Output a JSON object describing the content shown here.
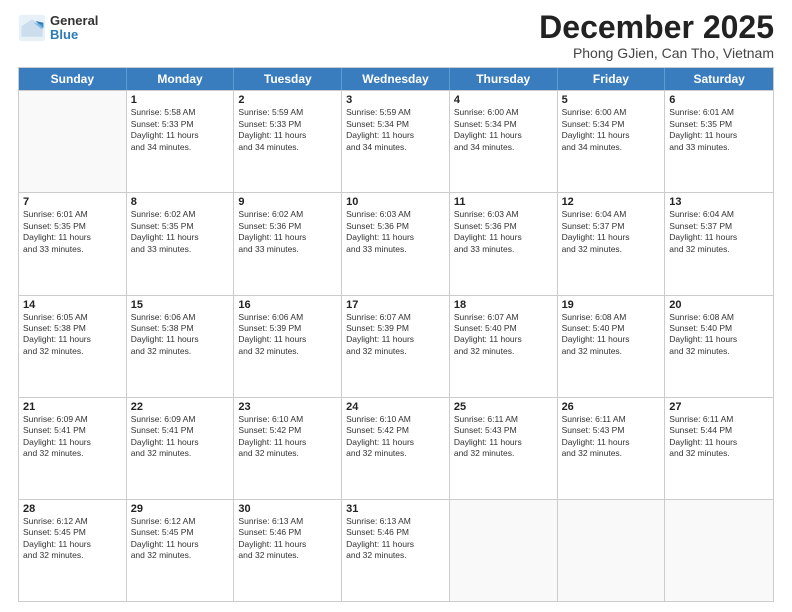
{
  "logo": {
    "general": "General",
    "blue": "Blue"
  },
  "title": "December 2025",
  "subtitle": "Phong GJien, Can Tho, Vietnam",
  "header_days": [
    "Sunday",
    "Monday",
    "Tuesday",
    "Wednesday",
    "Thursday",
    "Friday",
    "Saturday"
  ],
  "weeks": [
    [
      {
        "day": "",
        "info": ""
      },
      {
        "day": "1",
        "info": "Sunrise: 5:58 AM\nSunset: 5:33 PM\nDaylight: 11 hours\nand 34 minutes."
      },
      {
        "day": "2",
        "info": "Sunrise: 5:59 AM\nSunset: 5:33 PM\nDaylight: 11 hours\nand 34 minutes."
      },
      {
        "day": "3",
        "info": "Sunrise: 5:59 AM\nSunset: 5:34 PM\nDaylight: 11 hours\nand 34 minutes."
      },
      {
        "day": "4",
        "info": "Sunrise: 6:00 AM\nSunset: 5:34 PM\nDaylight: 11 hours\nand 34 minutes."
      },
      {
        "day": "5",
        "info": "Sunrise: 6:00 AM\nSunset: 5:34 PM\nDaylight: 11 hours\nand 34 minutes."
      },
      {
        "day": "6",
        "info": "Sunrise: 6:01 AM\nSunset: 5:35 PM\nDaylight: 11 hours\nand 33 minutes."
      }
    ],
    [
      {
        "day": "7",
        "info": "Sunrise: 6:01 AM\nSunset: 5:35 PM\nDaylight: 11 hours\nand 33 minutes."
      },
      {
        "day": "8",
        "info": "Sunrise: 6:02 AM\nSunset: 5:35 PM\nDaylight: 11 hours\nand 33 minutes."
      },
      {
        "day": "9",
        "info": "Sunrise: 6:02 AM\nSunset: 5:36 PM\nDaylight: 11 hours\nand 33 minutes."
      },
      {
        "day": "10",
        "info": "Sunrise: 6:03 AM\nSunset: 5:36 PM\nDaylight: 11 hours\nand 33 minutes."
      },
      {
        "day": "11",
        "info": "Sunrise: 6:03 AM\nSunset: 5:36 PM\nDaylight: 11 hours\nand 33 minutes."
      },
      {
        "day": "12",
        "info": "Sunrise: 6:04 AM\nSunset: 5:37 PM\nDaylight: 11 hours\nand 32 minutes."
      },
      {
        "day": "13",
        "info": "Sunrise: 6:04 AM\nSunset: 5:37 PM\nDaylight: 11 hours\nand 32 minutes."
      }
    ],
    [
      {
        "day": "14",
        "info": "Sunrise: 6:05 AM\nSunset: 5:38 PM\nDaylight: 11 hours\nand 32 minutes."
      },
      {
        "day": "15",
        "info": "Sunrise: 6:06 AM\nSunset: 5:38 PM\nDaylight: 11 hours\nand 32 minutes."
      },
      {
        "day": "16",
        "info": "Sunrise: 6:06 AM\nSunset: 5:39 PM\nDaylight: 11 hours\nand 32 minutes."
      },
      {
        "day": "17",
        "info": "Sunrise: 6:07 AM\nSunset: 5:39 PM\nDaylight: 11 hours\nand 32 minutes."
      },
      {
        "day": "18",
        "info": "Sunrise: 6:07 AM\nSunset: 5:40 PM\nDaylight: 11 hours\nand 32 minutes."
      },
      {
        "day": "19",
        "info": "Sunrise: 6:08 AM\nSunset: 5:40 PM\nDaylight: 11 hours\nand 32 minutes."
      },
      {
        "day": "20",
        "info": "Sunrise: 6:08 AM\nSunset: 5:40 PM\nDaylight: 11 hours\nand 32 minutes."
      }
    ],
    [
      {
        "day": "21",
        "info": "Sunrise: 6:09 AM\nSunset: 5:41 PM\nDaylight: 11 hours\nand 32 minutes."
      },
      {
        "day": "22",
        "info": "Sunrise: 6:09 AM\nSunset: 5:41 PM\nDaylight: 11 hours\nand 32 minutes."
      },
      {
        "day": "23",
        "info": "Sunrise: 6:10 AM\nSunset: 5:42 PM\nDaylight: 11 hours\nand 32 minutes."
      },
      {
        "day": "24",
        "info": "Sunrise: 6:10 AM\nSunset: 5:42 PM\nDaylight: 11 hours\nand 32 minutes."
      },
      {
        "day": "25",
        "info": "Sunrise: 6:11 AM\nSunset: 5:43 PM\nDaylight: 11 hours\nand 32 minutes."
      },
      {
        "day": "26",
        "info": "Sunrise: 6:11 AM\nSunset: 5:43 PM\nDaylight: 11 hours\nand 32 minutes."
      },
      {
        "day": "27",
        "info": "Sunrise: 6:11 AM\nSunset: 5:44 PM\nDaylight: 11 hours\nand 32 minutes."
      }
    ],
    [
      {
        "day": "28",
        "info": "Sunrise: 6:12 AM\nSunset: 5:45 PM\nDaylight: 11 hours\nand 32 minutes."
      },
      {
        "day": "29",
        "info": "Sunrise: 6:12 AM\nSunset: 5:45 PM\nDaylight: 11 hours\nand 32 minutes."
      },
      {
        "day": "30",
        "info": "Sunrise: 6:13 AM\nSunset: 5:46 PM\nDaylight: 11 hours\nand 32 minutes."
      },
      {
        "day": "31",
        "info": "Sunrise: 6:13 AM\nSunset: 5:46 PM\nDaylight: 11 hours\nand 32 minutes."
      },
      {
        "day": "",
        "info": ""
      },
      {
        "day": "",
        "info": ""
      },
      {
        "day": "",
        "info": ""
      }
    ]
  ]
}
